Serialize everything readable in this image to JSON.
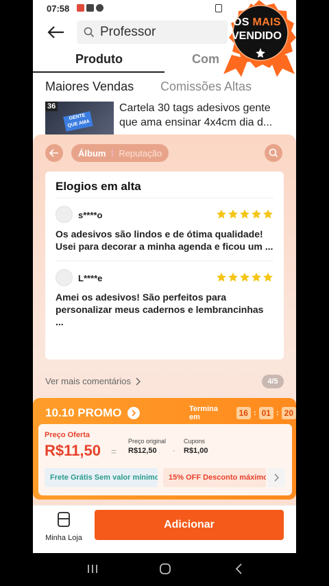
{
  "status_bar": {
    "time": "07:58"
  },
  "search": {
    "query": "Professor"
  },
  "tabs": [
    {
      "label": "Produto"
    },
    {
      "label": "Com"
    }
  ],
  "badge": {
    "line1_white": "OS ",
    "line1_orange": "MAIS",
    "line2": "VENDIDO"
  },
  "sort": {
    "best_sellers": "Maiores Vendas",
    "high_commissions": "Comissões Altas"
  },
  "product": {
    "rank": "36",
    "thumb_text": "GENTE QUE AMA",
    "title": "Cartela 30 tags adesivos gente que ama ensinar 4x4cm dia d..."
  },
  "panel": {
    "album": "Álbum",
    "reputation": "Reputação",
    "reviews_title": "Elogios em alta",
    "reviews": [
      {
        "user": "s****o",
        "text": "Os adesivos são lindos e de ótima qualidade! Usei para decorar a minha agenda e ficou um ...",
        "stars": 5
      },
      {
        "user": "L****e",
        "text": "Amei os adesivos! São perfeitos para personalizar meus cadernos e lembrancinhas ...",
        "stars": 5
      }
    ],
    "more_comments": "Ver mais comentários",
    "page_indicator": "4/5"
  },
  "promo": {
    "title": "10.10 PROMO",
    "ends_in": "Termina em",
    "timer": {
      "h": "16",
      "m": "01",
      "s": "20"
    },
    "offer_label": "Preço Oferta",
    "offer_price": "R$11,50",
    "equals": "=",
    "original_label": "Preço original",
    "original_price": "R$12,50",
    "minus": "-",
    "coupons_label": "Cupons",
    "coupons_value": "R$1,00",
    "chip_shipping": "Frete Grátis Sem valor mínimo",
    "chip_discount": "15% OFF Desconto máximo"
  },
  "bottom": {
    "shop_label": "Minha Loja",
    "add_button": "Adicionar"
  },
  "colors": {
    "accent": "#f55a1a",
    "promo": "#ff9d2a",
    "price": "#e8412b",
    "star": "#f5c518"
  }
}
